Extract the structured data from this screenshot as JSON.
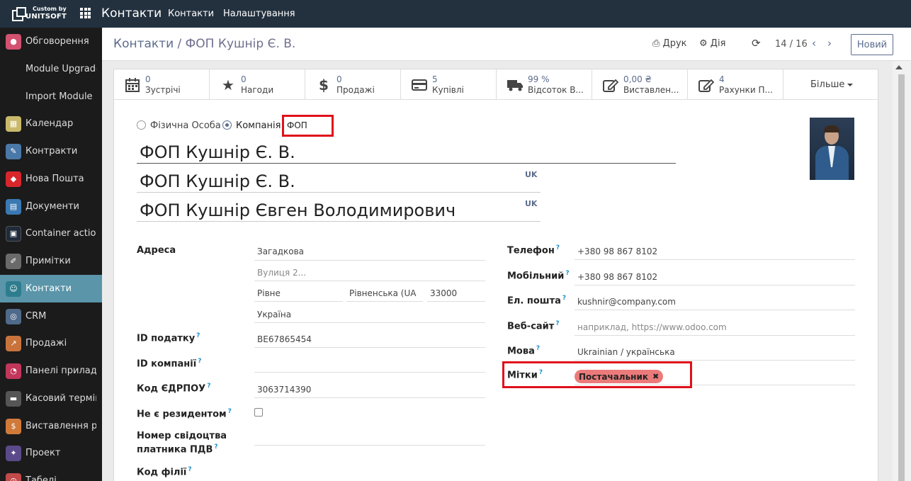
{
  "topbar": {
    "logo_line1": "Custom by",
    "logo_line2": "UNITSOFT",
    "app_title": "Контакти",
    "menu": [
      "Контакти",
      "Налаштування"
    ]
  },
  "sidebar": {
    "items": [
      {
        "label": "Обговорення",
        "icon": "chat-icon",
        "color": "#d35270"
      },
      {
        "label": "Module Upgrade",
        "icon": ""
      },
      {
        "label": "Import Module",
        "icon": ""
      },
      {
        "label": "Календар",
        "icon": "calendar-icon",
        "color": "#c9b96a"
      },
      {
        "label": "Контракти",
        "icon": "contract-icon",
        "color": "#4a78a8"
      },
      {
        "label": "Нова Пошта",
        "icon": "nova-poshta-icon",
        "color": "#d8262b"
      },
      {
        "label": "Документи",
        "icon": "documents-icon",
        "color": "#3a79b2"
      },
      {
        "label": "Container actions",
        "icon": "container-icon",
        "color": "#1f2a3a"
      },
      {
        "label": "Примітки",
        "icon": "notes-icon",
        "color": "#6a6a6a"
      },
      {
        "label": "Контакти",
        "icon": "contacts-icon",
        "color": "#2e7d8f"
      },
      {
        "label": "CRM",
        "icon": "crm-icon",
        "color": "#4f6a8a"
      },
      {
        "label": "Продажі",
        "icon": "sales-icon",
        "color": "#c8733c"
      },
      {
        "label": "Панелі приладів",
        "icon": "dashboard-icon",
        "color": "#c2365a"
      },
      {
        "label": "Касовий термін...",
        "icon": "pos-icon",
        "color": "#555555"
      },
      {
        "label": "Виставлення ра...",
        "icon": "invoice-icon",
        "color": "#d07a3a"
      },
      {
        "label": "Проект",
        "icon": "project-icon",
        "color": "#5a4a8a"
      },
      {
        "label": "Табелі",
        "icon": "timesheet-icon",
        "color": "#c24a4a"
      }
    ]
  },
  "control": {
    "breadcrumb_root": "Контакти",
    "breadcrumb_sep": "/",
    "breadcrumb_current": "ФОП Кушнір Є. В.",
    "print_label": "Друк",
    "action_label": "Дія",
    "pager": "14 / 16",
    "new_button": "Новий"
  },
  "stats": [
    {
      "value": "0",
      "label": "Зустрічі",
      "icon": "calendar-icon"
    },
    {
      "value": "0",
      "label": "Нагоди",
      "icon": "star-icon"
    },
    {
      "value": "0",
      "label": "Продажі",
      "icon": "dollar-icon"
    },
    {
      "value": "5",
      "label": "Купівлі",
      "icon": "credit-card-icon"
    },
    {
      "value": "99 %",
      "label": "Відсоток В...",
      "icon": "truck-icon"
    },
    {
      "value": "0,00 ₴",
      "label": "Виставлен...",
      "icon": "pencil-square-icon"
    },
    {
      "value": "4",
      "label": "Рахунки П...",
      "icon": "pencil-square-icon"
    }
  ],
  "stats_more": "Більше",
  "form": {
    "type_individual": "Фізична Особа",
    "type_company": "Компанія",
    "company_prefix": "ФОП",
    "name": "ФОП Кушнір Є. В.",
    "name_uk": "ФОП Кушнір Є. В.",
    "full_name": "ФОП Кушнір Євген Володимирович",
    "lang_badge": "UK",
    "address_label": "Адреса",
    "street": "Загадкова",
    "street2_placeholder": "Вулиця 2...",
    "city": "Рівне",
    "state": "Рівненська (UA",
    "zip": "33000",
    "country": "Україна",
    "tax_id_label": "ID податку",
    "tax_id": "BE67865454",
    "company_id_label": "ID компанії",
    "edrpou_label": "Код ЄДРПОУ",
    "edrpou": "3063714390",
    "nonresident_label": "Не є резидентом",
    "vat_cert_label_1": "Номер свідоцтва",
    "vat_cert_label_2": "платника ПДВ",
    "branch_code_label": "Код філії",
    "phone_label": "Телефон",
    "phone": "+380 98 867 8102",
    "mobile_label": "Мобільний",
    "mobile": "+380 98 867 8102",
    "email_label": "Ел. пошта",
    "email": "kushnir@company.com",
    "website_label": "Веб-сайт",
    "website_placeholder": "наприклад, https://www.odoo.com",
    "language_label": "Мова",
    "language": "Ukrainian / українська",
    "tags_label": "Мітки",
    "tag": "Постачальник",
    "help_mark": "?"
  }
}
